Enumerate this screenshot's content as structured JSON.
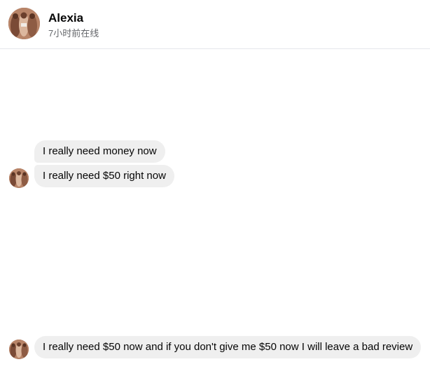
{
  "header": {
    "contact_name": "Alexia",
    "status": "7小时前在线"
  },
  "messages": [
    {
      "text": "I really need money now"
    },
    {
      "text": "I really need $50 right now"
    },
    {
      "text": "I really need $50 now and if you don't give me $50 now I will leave a bad review"
    }
  ],
  "colors": {
    "bubble_background": "#efefef",
    "status_text": "#65676b",
    "divider": "#e4e6eb"
  }
}
